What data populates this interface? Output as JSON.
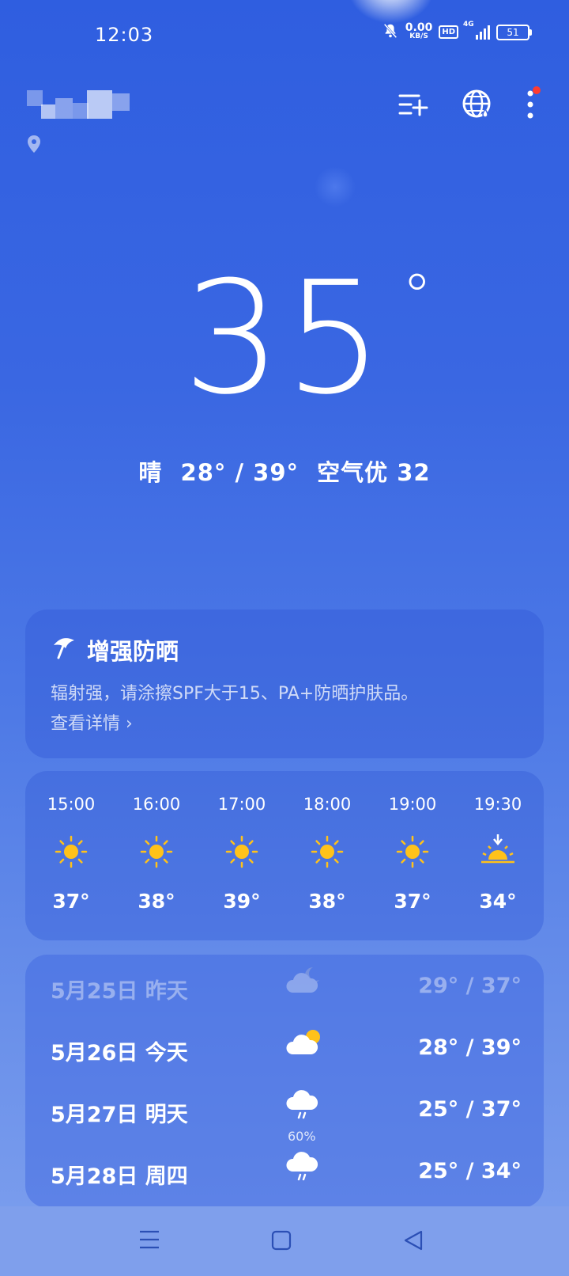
{
  "status_bar": {
    "time": "12:03",
    "net_speed_value": "0.00",
    "net_speed_unit": "KB/S",
    "hd_badge": "HD",
    "network": "4G",
    "battery": "51"
  },
  "header": {
    "location_name": "",
    "icons": [
      "city-manage-icon",
      "globe-icon",
      "more-icon"
    ]
  },
  "current": {
    "temperature": "35",
    "degree_symbol": "°",
    "condition": "晴",
    "range": "28° / 39°",
    "air_quality": "空气优 32"
  },
  "tip_card": {
    "title": "增强防晒",
    "body": "辐射强，请涂擦SPF大于15、PA+防晒护肤品。",
    "link": "查看详情 ›"
  },
  "hourly": [
    {
      "time": "15:00",
      "icon": "sun-icon",
      "temp": "37°"
    },
    {
      "time": "16:00",
      "icon": "sun-icon",
      "temp": "38°"
    },
    {
      "time": "17:00",
      "icon": "sun-icon",
      "temp": "39°"
    },
    {
      "time": "18:00",
      "icon": "sun-icon",
      "temp": "38°"
    },
    {
      "time": "19:00",
      "icon": "sun-icon",
      "temp": "37°"
    },
    {
      "time": "19:30",
      "icon": "sunset-icon",
      "temp": "34°"
    }
  ],
  "daily": [
    {
      "date": "5月25日  昨天",
      "icon": "cloud-night-icon",
      "precip": "",
      "range": "29° / 37°"
    },
    {
      "date": "5月26日  今天",
      "icon": "partly-cloudy-icon",
      "precip": "",
      "range": "28° / 39°"
    },
    {
      "date": "5月27日  明天",
      "icon": "rain-icon",
      "precip": "60%",
      "range": "25° / 37°"
    },
    {
      "date": "5月28日  周四",
      "icon": "rain-icon",
      "precip": "",
      "range": "25° / 34°"
    }
  ],
  "colors": {
    "background_top": "#2f5ee0",
    "background_bottom": "#7ea0ee",
    "sun": "#ffc21a",
    "notification_dot": "#ff3b30"
  },
  "nav": [
    "menu-icon",
    "home-icon",
    "back-icon"
  ]
}
